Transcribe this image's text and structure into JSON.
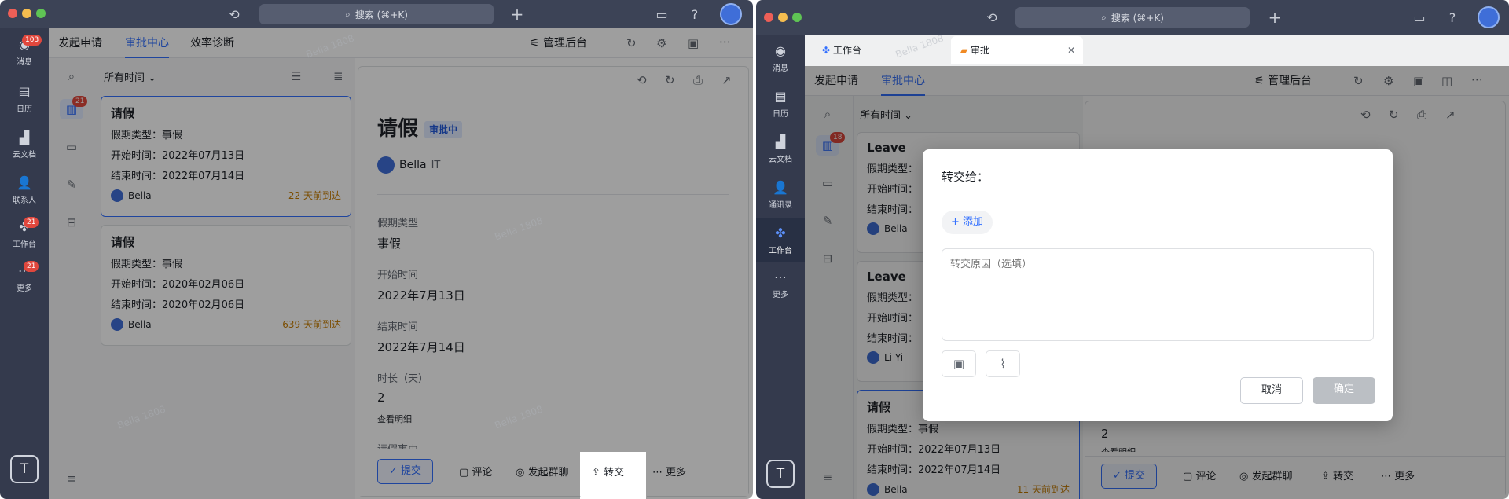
{
  "left": {
    "search_label": "搜索 (⌘+K)",
    "rail": [
      {
        "label": "消息",
        "badge": "103"
      },
      {
        "label": "日历",
        "badge": ""
      },
      {
        "label": "云文档",
        "badge": ""
      },
      {
        "label": "联系人",
        "badge": ""
      },
      {
        "label": "工作台",
        "badge": "21"
      },
      {
        "label": "更多",
        "badge": "21"
      }
    ],
    "rail_bottom": "T",
    "tabs": [
      "发起申请",
      "审批中心",
      "效率诊断"
    ],
    "admin_label": "管理后台",
    "filter_label": "所有时间",
    "inbox_badge": "21",
    "cards": [
      {
        "title": "请假",
        "rows": [
          "假期类型：事假",
          "开始时间：2022年07月13日",
          "结束时间：2022年07月14日"
        ],
        "user": "Bella",
        "time": "22 天前到达"
      },
      {
        "title": "请假",
        "rows": [
          "假期类型：事假",
          "开始时间：2020年02月06日",
          "结束时间：2020年02月06日"
        ],
        "user": "Bella",
        "time": "639 天前到达"
      }
    ],
    "detail": {
      "title": "请假",
      "status": "审批中",
      "user": "Bella",
      "dept": "IT",
      "fields": [
        {
          "label": "假期类型",
          "value": "事假"
        },
        {
          "label": "开始时间",
          "value": "2022年7月13日"
        },
        {
          "label": "结束时间",
          "value": "2022年7月14日"
        },
        {
          "label": "时长（天）",
          "value": "2"
        }
      ],
      "view_detail": "查看明细",
      "cut_label": "请假事由"
    },
    "actions": {
      "submit": "提交",
      "comment": "评论",
      "group": "发起群聊",
      "transfer": "转交",
      "more": "更多"
    }
  },
  "right": {
    "search_label": "搜索 (⌘+K)",
    "rail": [
      {
        "label": "消息"
      },
      {
        "label": "日历"
      },
      {
        "label": "云文档"
      },
      {
        "label": "通讯录"
      },
      {
        "label": "工作台"
      },
      {
        "label": "更多"
      }
    ],
    "rail_bottom": "T",
    "doc_tabs": [
      "工作台",
      "审批"
    ],
    "tabs": [
      "发起申请",
      "审批中心"
    ],
    "admin_label": "管理后台",
    "filter_label": "所有时间",
    "inbox_badge": "18",
    "cards": [
      {
        "title": "Leave",
        "rows": [
          "假期类型：",
          "开始时间：",
          "结束时间："
        ],
        "user": "Bella"
      },
      {
        "title": "Leave",
        "rows": [
          "假期类型：",
          "开始时间：",
          "结束时间："
        ],
        "user": "Li Yi"
      },
      {
        "title": "请假",
        "rows": [
          "假期类型：事假",
          "开始时间：2022年07月13日",
          "结束时间：2022年07月14日"
        ],
        "user": "Bella",
        "time": "11 天前到达"
      }
    ],
    "detail_value": "2",
    "detail_link": "查看明细",
    "actions": {
      "submit": "提交",
      "comment": "评论",
      "group": "发起群聊",
      "transfer": "转交",
      "more": "更多"
    },
    "modal": {
      "title": "转交给：",
      "add": "添加",
      "placeholder": "转交原因（选填）",
      "cancel": "取消",
      "confirm": "确定"
    }
  },
  "watermark": "Bella 1808"
}
